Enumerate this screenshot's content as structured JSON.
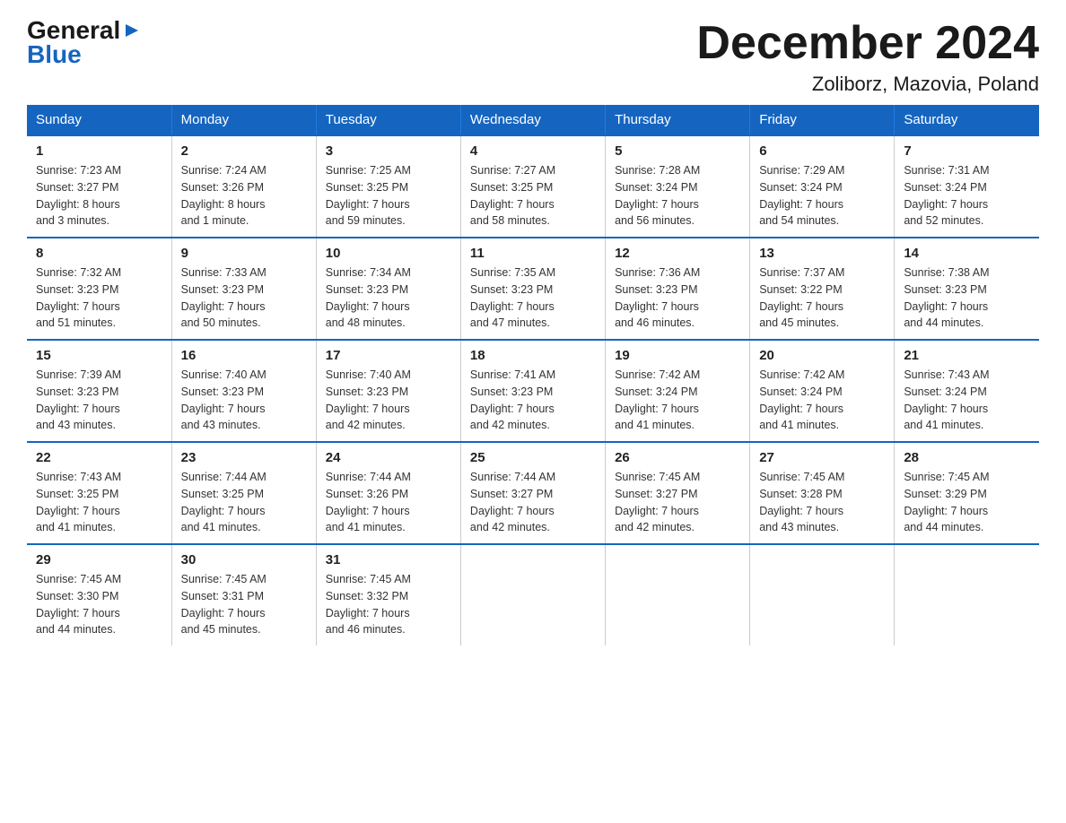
{
  "logo": {
    "part1": "General",
    "triangle": "▶",
    "part2": "Blue"
  },
  "title": "December 2024",
  "subtitle": "Zoliborz, Mazovia, Poland",
  "weekdays": [
    "Sunday",
    "Monday",
    "Tuesday",
    "Wednesday",
    "Thursday",
    "Friday",
    "Saturday"
  ],
  "weeks": [
    [
      {
        "day": "1",
        "info": "Sunrise: 7:23 AM\nSunset: 3:27 PM\nDaylight: 8 hours\nand 3 minutes."
      },
      {
        "day": "2",
        "info": "Sunrise: 7:24 AM\nSunset: 3:26 PM\nDaylight: 8 hours\nand 1 minute."
      },
      {
        "day": "3",
        "info": "Sunrise: 7:25 AM\nSunset: 3:25 PM\nDaylight: 7 hours\nand 59 minutes."
      },
      {
        "day": "4",
        "info": "Sunrise: 7:27 AM\nSunset: 3:25 PM\nDaylight: 7 hours\nand 58 minutes."
      },
      {
        "day": "5",
        "info": "Sunrise: 7:28 AM\nSunset: 3:24 PM\nDaylight: 7 hours\nand 56 minutes."
      },
      {
        "day": "6",
        "info": "Sunrise: 7:29 AM\nSunset: 3:24 PM\nDaylight: 7 hours\nand 54 minutes."
      },
      {
        "day": "7",
        "info": "Sunrise: 7:31 AM\nSunset: 3:24 PM\nDaylight: 7 hours\nand 52 minutes."
      }
    ],
    [
      {
        "day": "8",
        "info": "Sunrise: 7:32 AM\nSunset: 3:23 PM\nDaylight: 7 hours\nand 51 minutes."
      },
      {
        "day": "9",
        "info": "Sunrise: 7:33 AM\nSunset: 3:23 PM\nDaylight: 7 hours\nand 50 minutes."
      },
      {
        "day": "10",
        "info": "Sunrise: 7:34 AM\nSunset: 3:23 PM\nDaylight: 7 hours\nand 48 minutes."
      },
      {
        "day": "11",
        "info": "Sunrise: 7:35 AM\nSunset: 3:23 PM\nDaylight: 7 hours\nand 47 minutes."
      },
      {
        "day": "12",
        "info": "Sunrise: 7:36 AM\nSunset: 3:23 PM\nDaylight: 7 hours\nand 46 minutes."
      },
      {
        "day": "13",
        "info": "Sunrise: 7:37 AM\nSunset: 3:22 PM\nDaylight: 7 hours\nand 45 minutes."
      },
      {
        "day": "14",
        "info": "Sunrise: 7:38 AM\nSunset: 3:23 PM\nDaylight: 7 hours\nand 44 minutes."
      }
    ],
    [
      {
        "day": "15",
        "info": "Sunrise: 7:39 AM\nSunset: 3:23 PM\nDaylight: 7 hours\nand 43 minutes."
      },
      {
        "day": "16",
        "info": "Sunrise: 7:40 AM\nSunset: 3:23 PM\nDaylight: 7 hours\nand 43 minutes."
      },
      {
        "day": "17",
        "info": "Sunrise: 7:40 AM\nSunset: 3:23 PM\nDaylight: 7 hours\nand 42 minutes."
      },
      {
        "day": "18",
        "info": "Sunrise: 7:41 AM\nSunset: 3:23 PM\nDaylight: 7 hours\nand 42 minutes."
      },
      {
        "day": "19",
        "info": "Sunrise: 7:42 AM\nSunset: 3:24 PM\nDaylight: 7 hours\nand 41 minutes."
      },
      {
        "day": "20",
        "info": "Sunrise: 7:42 AM\nSunset: 3:24 PM\nDaylight: 7 hours\nand 41 minutes."
      },
      {
        "day": "21",
        "info": "Sunrise: 7:43 AM\nSunset: 3:24 PM\nDaylight: 7 hours\nand 41 minutes."
      }
    ],
    [
      {
        "day": "22",
        "info": "Sunrise: 7:43 AM\nSunset: 3:25 PM\nDaylight: 7 hours\nand 41 minutes."
      },
      {
        "day": "23",
        "info": "Sunrise: 7:44 AM\nSunset: 3:25 PM\nDaylight: 7 hours\nand 41 minutes."
      },
      {
        "day": "24",
        "info": "Sunrise: 7:44 AM\nSunset: 3:26 PM\nDaylight: 7 hours\nand 41 minutes."
      },
      {
        "day": "25",
        "info": "Sunrise: 7:44 AM\nSunset: 3:27 PM\nDaylight: 7 hours\nand 42 minutes."
      },
      {
        "day": "26",
        "info": "Sunrise: 7:45 AM\nSunset: 3:27 PM\nDaylight: 7 hours\nand 42 minutes."
      },
      {
        "day": "27",
        "info": "Sunrise: 7:45 AM\nSunset: 3:28 PM\nDaylight: 7 hours\nand 43 minutes."
      },
      {
        "day": "28",
        "info": "Sunrise: 7:45 AM\nSunset: 3:29 PM\nDaylight: 7 hours\nand 44 minutes."
      }
    ],
    [
      {
        "day": "29",
        "info": "Sunrise: 7:45 AM\nSunset: 3:30 PM\nDaylight: 7 hours\nand 44 minutes."
      },
      {
        "day": "30",
        "info": "Sunrise: 7:45 AM\nSunset: 3:31 PM\nDaylight: 7 hours\nand 45 minutes."
      },
      {
        "day": "31",
        "info": "Sunrise: 7:45 AM\nSunset: 3:32 PM\nDaylight: 7 hours\nand 46 minutes."
      },
      {
        "day": "",
        "info": ""
      },
      {
        "day": "",
        "info": ""
      },
      {
        "day": "",
        "info": ""
      },
      {
        "day": "",
        "info": ""
      }
    ]
  ]
}
